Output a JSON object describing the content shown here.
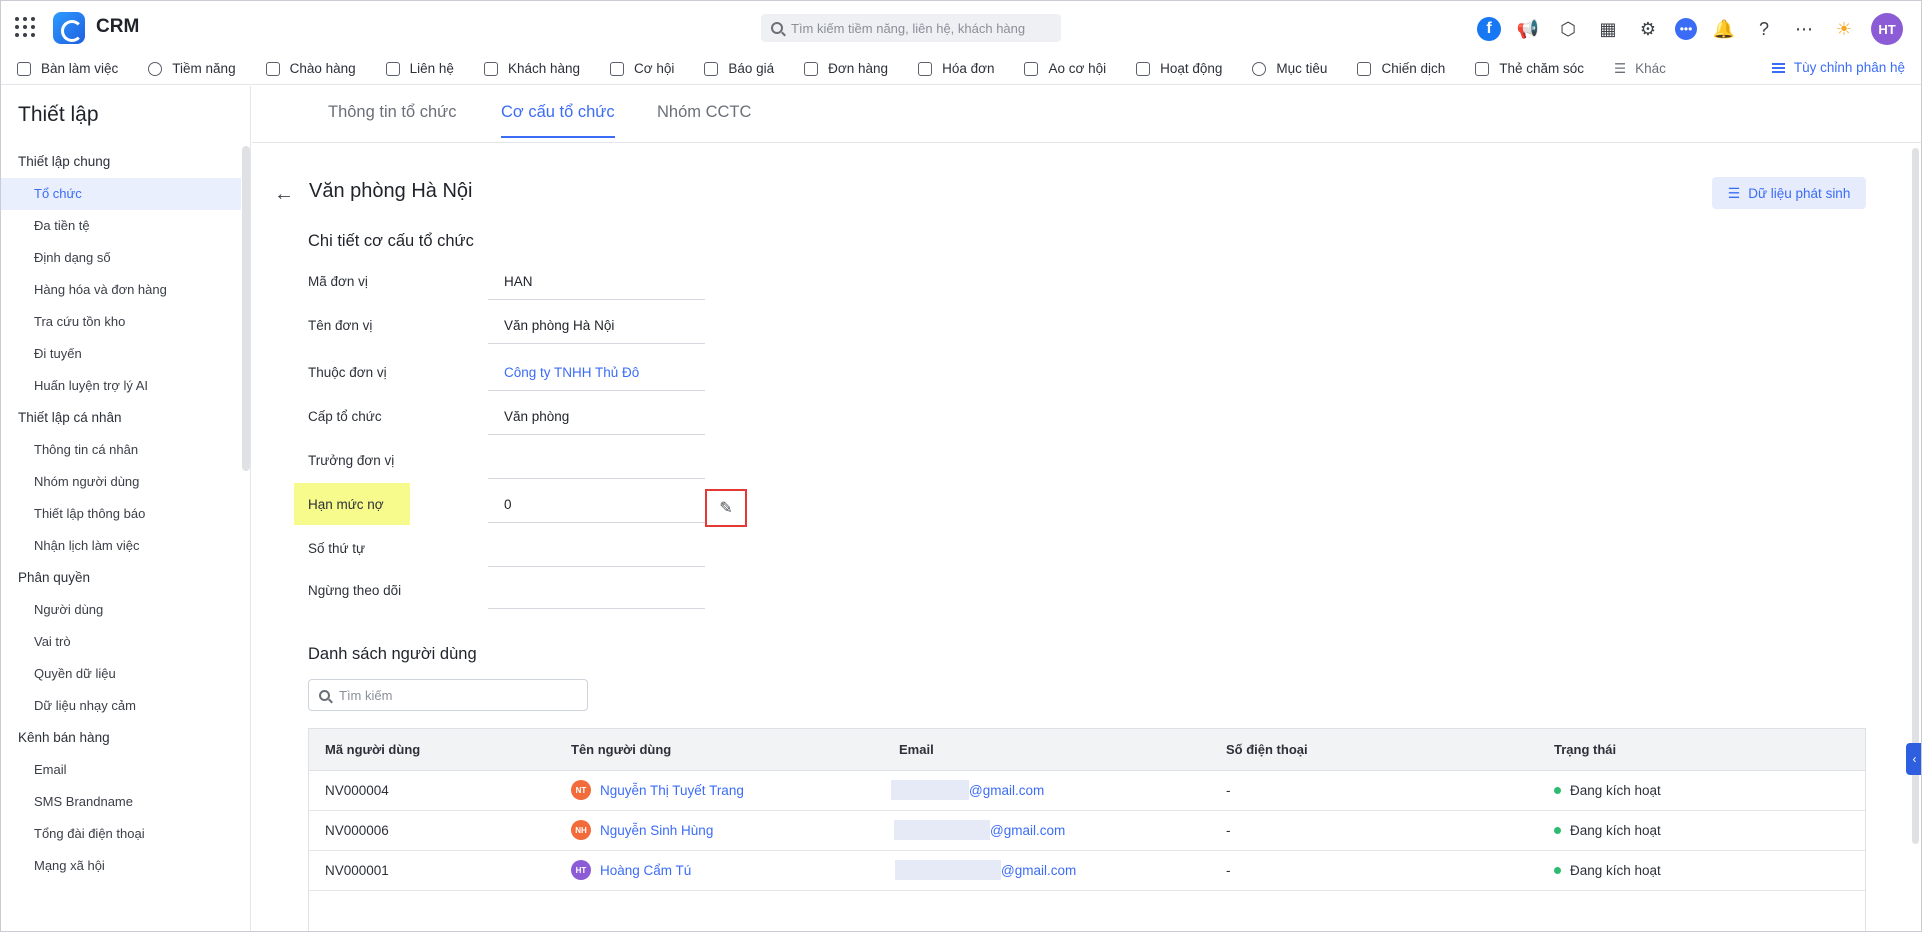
{
  "app": {
    "brand": "CRM"
  },
  "search": {
    "placeholder": "Tìm kiếm tiềm năng, liên hệ, khách hàng"
  },
  "top_icons": [
    "facebook-icon",
    "megaphone-icon",
    "box-icon",
    "calendar-icon",
    "gear-icon",
    "chat-icon",
    "bell-icon",
    "help-icon",
    "more-icon",
    "sun-icon"
  ],
  "avatar": {
    "initials": "HT",
    "color": "#8b5cd6"
  },
  "nav": {
    "items": [
      "Bàn làm việc",
      "Tiềm năng",
      "Chào hàng",
      "Liên hệ",
      "Khách hàng",
      "Cơ hội",
      "Báo giá",
      "Đơn hàng",
      "Hóa đơn",
      "Ao cơ hội",
      "Hoạt động",
      "Mục tiêu",
      "Chiến dịch",
      "Thẻ chăm sóc",
      "Khác"
    ],
    "customize": "Tùy chỉnh phân hệ"
  },
  "sidebar": {
    "title": "Thiết lập",
    "groups": [
      {
        "label": "Thiết lập chung",
        "items": [
          "Tổ chức",
          "Đa tiền tệ",
          "Định dạng số",
          "Hàng hóa và đơn hàng",
          "Tra cứu tồn kho",
          "Đi tuyến",
          "Huấn luyện trợ lý AI"
        ]
      },
      {
        "label": "Thiết lập cá nhân",
        "items": [
          "Thông tin cá nhân",
          "Nhóm người dùng",
          "Thiết lập thông báo",
          "Nhận lịch làm việc"
        ]
      },
      {
        "label": "Phân quyền",
        "items": [
          "Người dùng",
          "Vai trò",
          "Quyền dữ liệu",
          "Dữ liệu nhạy cảm"
        ]
      },
      {
        "label": "Kênh bán hàng",
        "items": [
          "Email",
          "SMS Brandname",
          "Tổng đài điện thoại",
          "Mạng xã hội"
        ]
      }
    ]
  },
  "tabs": [
    "Thông tin tổ chức",
    "Cơ cấu tổ chức",
    "Nhóm CCTC"
  ],
  "page": {
    "title": "Văn phòng Hà Nội",
    "data_button": "Dữ liệu phát sinh",
    "section_title": "Chi tiết cơ cấu tổ chức"
  },
  "fields": [
    {
      "label": "Mã đơn vị",
      "value": "HAN"
    },
    {
      "label": "Tên đơn vị",
      "value": "Văn phòng Hà Nội"
    },
    {
      "label": "Thuộc đơn vị",
      "value": "Công ty TNHH Thủ Đô"
    },
    {
      "label": "Cấp tổ chức",
      "value": "Văn phòng"
    },
    {
      "label": "Trưởng đơn vị",
      "value": ""
    },
    {
      "label": "Hạn mức nợ",
      "value": "0"
    },
    {
      "label": "Số thứ tự",
      "value": ""
    },
    {
      "label": "Ngừng theo dõi",
      "value": ""
    }
  ],
  "users": {
    "title": "Danh sách người dùng",
    "search_placeholder": "Tìm kiếm",
    "columns": [
      "Mã người dùng",
      "Tên người dùng",
      "Email",
      "Số điện thoại",
      "Trạng thái"
    ],
    "rows": [
      {
        "code": "NV000004",
        "initials": "NT",
        "name": "Nguyễn Thị Tuyết Trang",
        "email_domain": "@gmail.com",
        "phone": "-",
        "status": "Đang kích hoạt",
        "color": "#f26b3a"
      },
      {
        "code": "NV000006",
        "initials": "NH",
        "name": "Nguyễn Sinh Hùng",
        "email_domain": "@gmail.com",
        "phone": "-",
        "status": "Đang kích hoạt",
        "color": "#f26b3a"
      },
      {
        "code": "NV000001",
        "initials": "HT",
        "name": "Hoàng Cẩm Tú",
        "email_domain": "@gmail.com",
        "phone": "-",
        "status": "Đang kích hoạt",
        "color": "#8b5cd6"
      }
    ]
  },
  "colors": {
    "accent": "#3b6cf6",
    "highlight": "#f7fb8b",
    "annotation": "#e53935",
    "active_status": "#2dbb6f"
  }
}
